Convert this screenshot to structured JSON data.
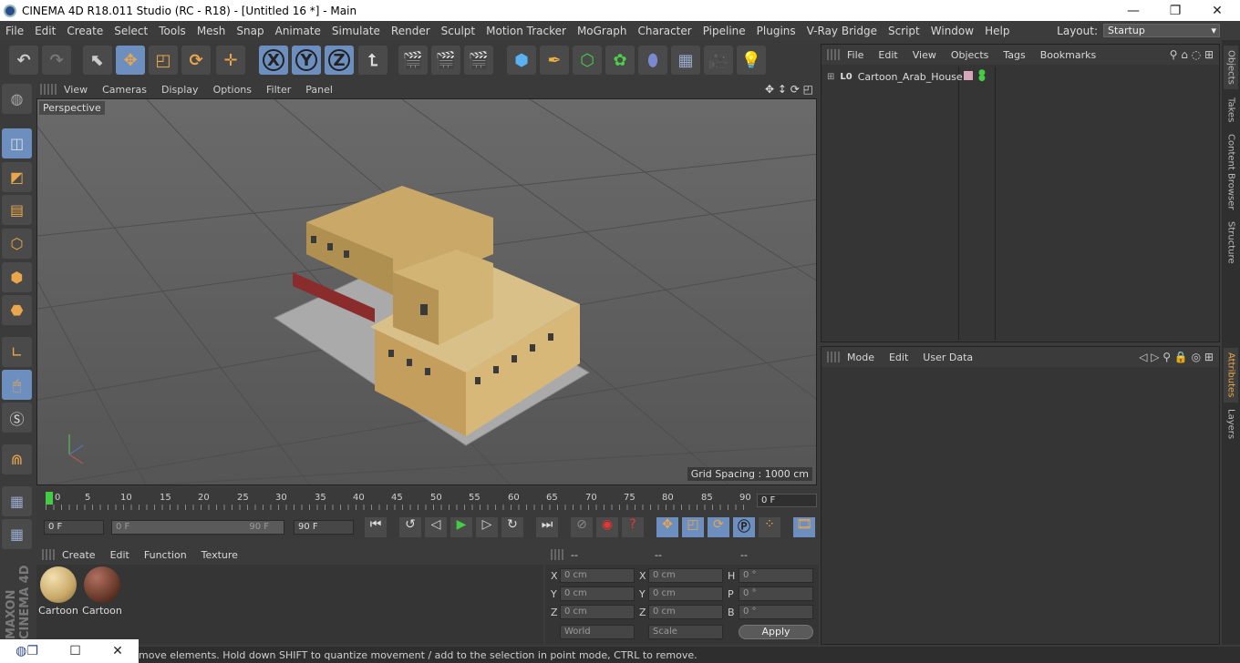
{
  "window": {
    "title": "CINEMA 4D R18.011 Studio (RC - R18) - [Untitled 16 *] - Main"
  },
  "menu": [
    "File",
    "Edit",
    "Create",
    "Select",
    "Tools",
    "Mesh",
    "Snap",
    "Animate",
    "Simulate",
    "Render",
    "Sculpt",
    "Motion Tracker",
    "MoGraph",
    "Character",
    "Pipeline",
    "Plugins",
    "V-Ray Bridge",
    "Script",
    "Window",
    "Help"
  ],
  "layout": {
    "label": "Layout:",
    "value": "Startup"
  },
  "toolbar": {
    "axis_x": "X",
    "axis_y": "Y",
    "axis_z": "Z"
  },
  "viewport": {
    "menu": [
      "View",
      "Cameras",
      "Display",
      "Options",
      "Filter",
      "Panel"
    ],
    "camera_label": "Perspective",
    "grid_spacing": "Grid Spacing : 1000 cm"
  },
  "timeline": {
    "ticks": [
      "0",
      "5",
      "10",
      "15",
      "20",
      "25",
      "30",
      "35",
      "40",
      "45",
      "50",
      "55",
      "60",
      "65",
      "70",
      "75",
      "80",
      "85",
      "90"
    ],
    "current_frame": "0 F"
  },
  "transport": {
    "start": "0 F",
    "range_start": "0 F",
    "range_end": "90 F",
    "end": "90 F"
  },
  "material_manager": {
    "menu": [
      "Create",
      "Edit",
      "Function",
      "Texture"
    ],
    "materials": [
      {
        "name": "Cartoon",
        "color": "#d8c08a"
      },
      {
        "name": "Cartoon",
        "color": "#6a3a2a"
      }
    ]
  },
  "coordinates": {
    "col_headers": [
      "--",
      "--",
      "--"
    ],
    "rows": [
      {
        "a": "X",
        "av": "0 cm",
        "b": "X",
        "bv": "0 cm",
        "c": "H",
        "cv": "0 °"
      },
      {
        "a": "Y",
        "av": "0 cm",
        "b": "Y",
        "bv": "0 cm",
        "c": "P",
        "cv": "0 °"
      },
      {
        "a": "Z",
        "av": "0 cm",
        "b": "Z",
        "bv": "0 cm",
        "c": "B",
        "cv": "0 °"
      }
    ],
    "mode_world": "World",
    "mode_scale": "Scale",
    "apply": "Apply"
  },
  "object_manager": {
    "menu": [
      "File",
      "Edit",
      "View",
      "Objects",
      "Tags",
      "Bookmarks"
    ],
    "objects": [
      {
        "name": "Cartoon_Arab_House"
      }
    ]
  },
  "attribute_manager": {
    "menu": [
      "Mode",
      "Edit",
      "User Data"
    ]
  },
  "right_tabs": [
    "Objects",
    "Takes",
    "Content Browser",
    "Structure",
    "Attributes",
    "Layers"
  ],
  "status": "move elements. Hold down SHIFT to quantize movement / add to the selection in point mode, CTRL to remove.",
  "brand": "MAXON CINEMA 4D"
}
